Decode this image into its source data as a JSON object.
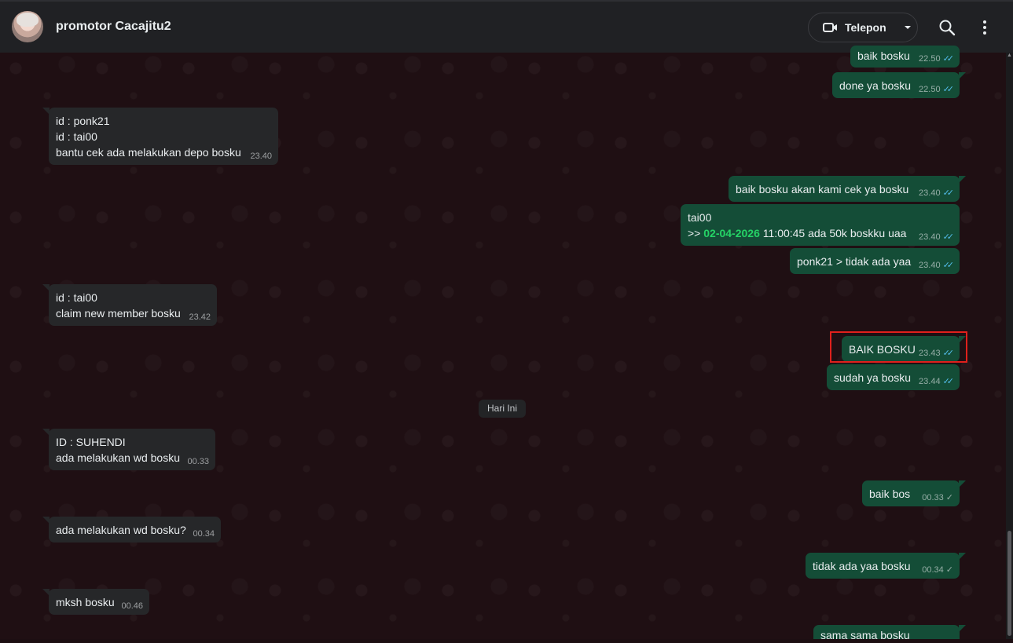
{
  "header": {
    "contact_name": "promotor Cacajitu2",
    "call_label": "Telepon",
    "icons": [
      "video-call-icon",
      "chevron-down-icon",
      "search-icon",
      "more-vert-icon"
    ]
  },
  "date_divider": "Hari Ini",
  "messages": [
    {
      "dir": "out",
      "lines": [
        "baik bosku"
      ],
      "time": "22.50",
      "status": "read"
    },
    {
      "dir": "out",
      "lines": [
        "done ya bosku"
      ],
      "time": "22.50",
      "status": "read"
    },
    {
      "dir": "in",
      "lines": [
        "id : ponk21",
        "id : tai00",
        "bantu cek ada melakukan depo bosku"
      ],
      "time": "23.40"
    },
    {
      "dir": "out",
      "lines": [
        "baik bosku akan kami cek ya bosku"
      ],
      "time": "23.40",
      "status": "read"
    },
    {
      "dir": "out",
      "lines": [
        "tai00"
      ],
      "line2_prefix": ">> ",
      "line2_date": "02-04-2026",
      "line2_rest": " 11:00:45 ada 50k boskku uaa",
      "time": "23.40",
      "status": "read"
    },
    {
      "dir": "out",
      "lines": [
        "ponk21 > tidak ada yaa"
      ],
      "time": "23.40",
      "status": "read"
    },
    {
      "dir": "in",
      "lines": [
        "id : tai00",
        "claim new member bosku"
      ],
      "time": "23.42"
    },
    {
      "dir": "out",
      "lines": [
        "BAIK BOSKU"
      ],
      "time": "23.43",
      "status": "read"
    },
    {
      "dir": "out",
      "lines": [
        "sudah ya bosku"
      ],
      "time": "23.44",
      "status": "read"
    },
    {
      "dir": "in",
      "lines": [
        "ID : SUHENDI",
        "ada melakukan wd bosku"
      ],
      "time": "00.33"
    },
    {
      "dir": "out",
      "lines": [
        "baik bos"
      ],
      "time": "00.33",
      "status": "sent"
    },
    {
      "dir": "in",
      "lines": [
        "ada melakukan wd bosku?"
      ],
      "time": "00.34"
    },
    {
      "dir": "out",
      "lines": [
        "tidak ada yaa bosku"
      ],
      "time": "00.34",
      "status": "sent"
    },
    {
      "dir": "in",
      "lines": [
        "mksh bosku"
      ],
      "time": "00.46"
    },
    {
      "dir": "out",
      "lines": [
        "sama sama bosku"
      ],
      "time": "",
      "status": ""
    }
  ],
  "colors": {
    "header_bg": "#202124",
    "incoming_bubble": "#262729",
    "outgoing_bubble": "#144d37",
    "read_tick": "#53bdeb",
    "date_highlight": "#25d366",
    "annotation_box": "#e0201c"
  }
}
